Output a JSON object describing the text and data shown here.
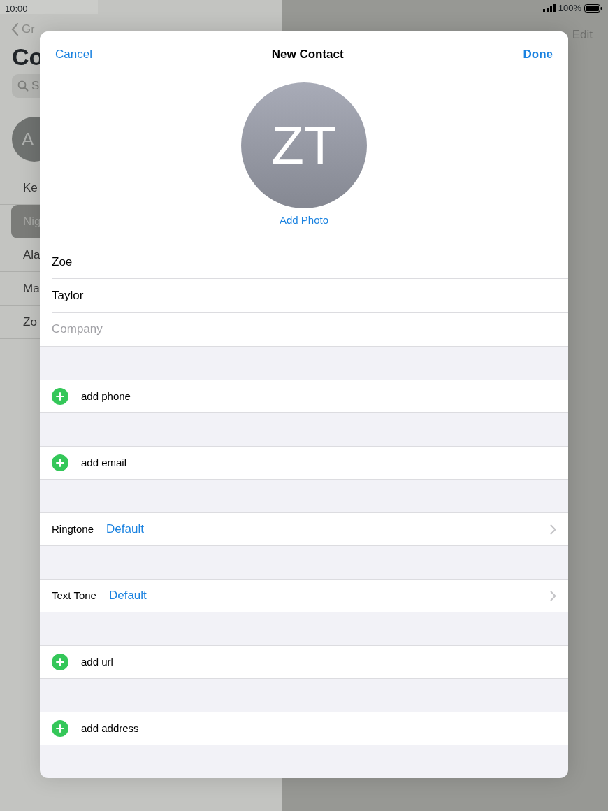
{
  "status_bar": {
    "time": "10:00",
    "battery": "100%"
  },
  "background": {
    "back_label": "Gr",
    "title": "Co",
    "search_placeholder": "S",
    "avatar_initials": "A",
    "edit": "Edit",
    "contacts": [
      {
        "name": "Ke",
        "selected": false
      },
      {
        "name": "Nig",
        "selected": true
      },
      {
        "name": "Ala",
        "selected": false
      },
      {
        "name": "Ma",
        "selected": false
      },
      {
        "name": "Zo",
        "selected": false
      }
    ]
  },
  "modal": {
    "cancel": "Cancel",
    "title": "New Contact",
    "done": "Done",
    "avatar_initials": "ZT",
    "add_photo": "Add Photo",
    "name_fields": [
      {
        "value": "Zoe"
      },
      {
        "value": "Taylor"
      },
      {
        "placeholder": "Company"
      }
    ],
    "rows": [
      {
        "kind": "add",
        "label": "add phone"
      },
      {
        "kind": "add",
        "label": "add email"
      },
      {
        "kind": "setting",
        "label": "Ringtone",
        "value": "Default"
      },
      {
        "kind": "setting",
        "label": "Text Tone",
        "value": "Default"
      },
      {
        "kind": "add",
        "label": "add url"
      },
      {
        "kind": "add",
        "label": "add address"
      }
    ]
  }
}
